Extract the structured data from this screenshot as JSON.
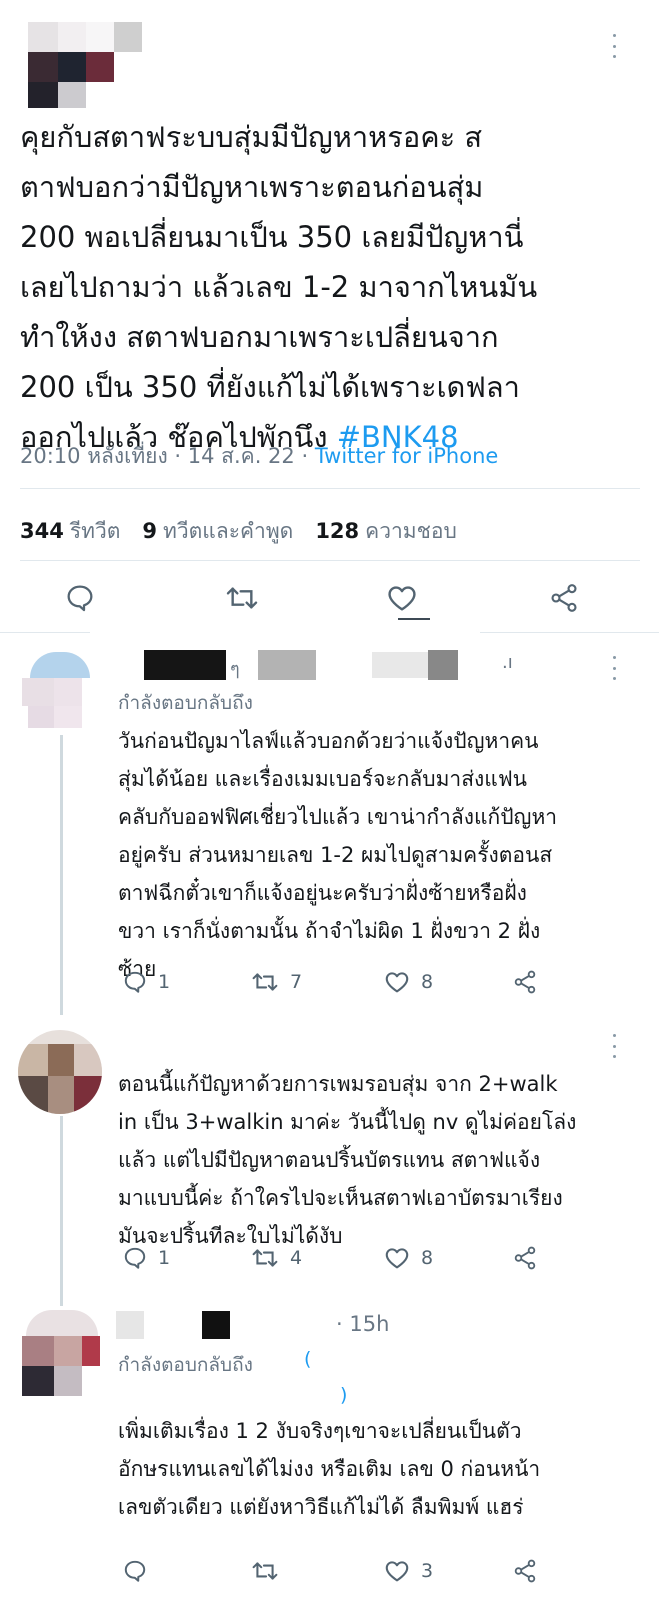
{
  "main_tweet": {
    "text_lines": [
      "คุยกับสตาฟระบบสุ่มมีปัญหาหรอคะ ส",
      "ตาฟบอกว่ามีปัญหาเพราะตอนก่อนสุ่ม",
      "200 พอเปลี่ยนมาเป็น 350 เลยมีปัญหานี่",
      "เลยไปถามว่า แล้วเลข 1-2 มาจากไหนมัน",
      "ทำให้งง สตาฟบอกมาเพราะเปลี่ยนจาก",
      "200 เป็น 350 ที่ยังแก้ไม่ได้เพราะเดฟลา",
      "ออกไปแล้ว ช๊อคไปพักนึง "
    ],
    "hashtag": "#BNK48",
    "timestamp": "20:10 หลังเที่ยง · 14 ส.ค. 22 · ",
    "source": "Twitter for iPhone",
    "stats": {
      "retweets_count": "344",
      "retweets_label": "รีทวีต",
      "quotes_count": "9",
      "quotes_label": "ทวีตและคำพูด",
      "likes_count": "128",
      "likes_label": "ความชอบ"
    },
    "icons": [
      "comment-icon",
      "retweet-icon",
      "like-icon",
      "share-icon"
    ]
  },
  "replies": [
    {
      "name_fragment": "ๆ",
      "name_fragment2": ".ı",
      "replying_label": "กำลังตอบกลับถึง",
      "text_lines": [
        "วันก่อนปัญมาไลฟ์แล้วบอกด้วยว่าแจ้งปัญหาคน",
        "สุ่มได้น้อย และเรื่องเมมเบอร์จะกลับมาส่งแฟน",
        "คลับกับออฟฟิศเชี่ยวไปแล้ว เขาน่ากำลังแก้ปัญหา",
        "อยู่ครับ ส่วนหมายเลข 1-2 ผมไปดูสามครั้งตอนส",
        "ตาฟฉีกตั๋วเขาก็แจ้งอยู่นะครับว่าฝั่งซ้ายหรือฝั่ง",
        "ขวา เราก็นั่งตามนั้น ถ้าจำไม่ผิด 1 ฝั่งขวา 2 ฝั่ง",
        "ซ้าย"
      ],
      "replies": "1",
      "retweets": "7",
      "likes": "8"
    },
    {
      "text_lines": [
        "ตอนนี้แก้ปัญหาด้วยการเพมรอบสุ่ม จาก 2+walk",
        "in เป็น 3+walkin มาค่ะ วันนี้ไปดู nv ดูไม่ค่อยโล่ง",
        "แล้ว แต่ไปมีปัญหาตอนปริ้นบัตรแทน สตาฟแจ้ง",
        "มาแบบนี้ค่ะ ถ้าใครไปจะเห็นสตาฟเอาบัตรมาเรียง",
        "มันจะปริ้นทีละใบไม่ได้งับ"
      ],
      "replies": "1",
      "retweets": "4",
      "likes": "8"
    },
    {
      "time": "· 15h",
      "replying_label": "กำลังตอบกลับถึง",
      "text_lines": [
        "เพิ่มเติมเรื่อง 1 2 งับจริงๆเขาจะเปลี่ยนเป็นตัว",
        "อักษรแทนเลขได้ไม่งง หรือเติม เลข 0 ก่อนหน้า",
        "เลขตัวเดียว แต่ยังหาวิธีแก้ไม่ได้ ลืมพิมพ์ แฮร่"
      ],
      "replies": "",
      "retweets": "",
      "likes": "3"
    }
  ],
  "colors": {
    "accent": "#1d9bf0",
    "text": "#14171a",
    "secondary": "#687684",
    "divider": "#e1e8ed"
  }
}
